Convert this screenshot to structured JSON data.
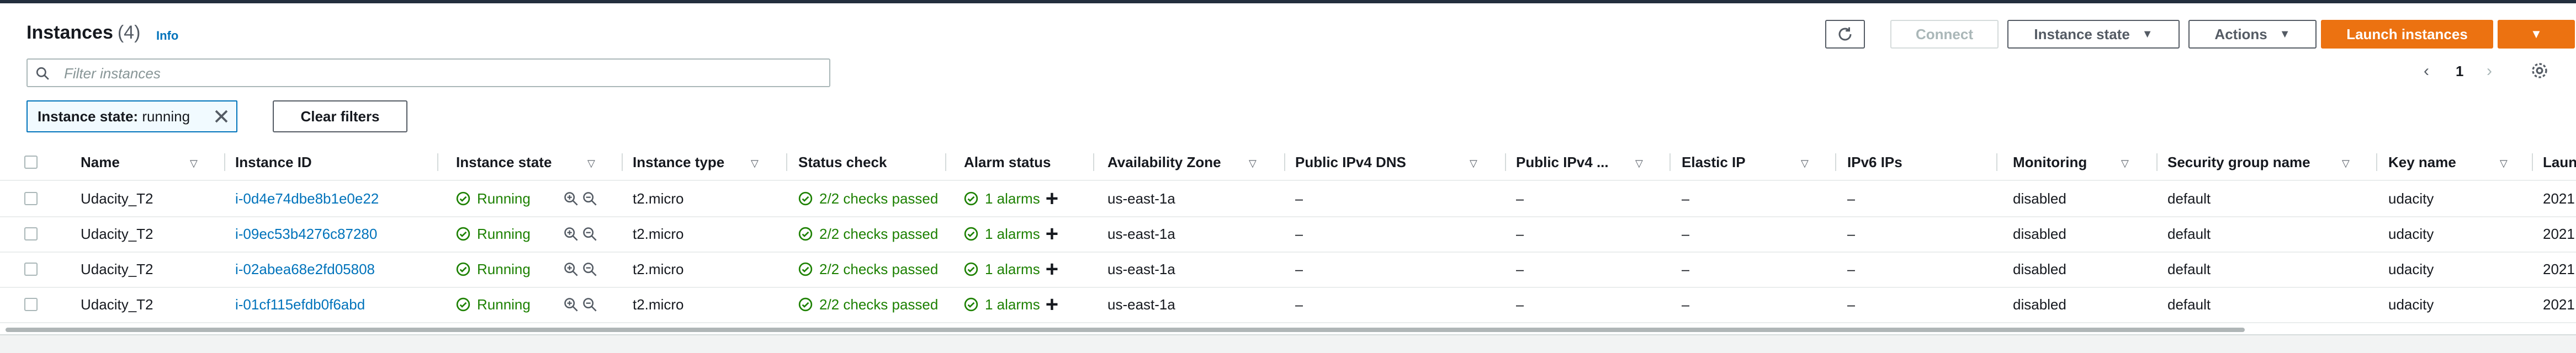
{
  "header": {
    "title": "Instances",
    "count": "(4)",
    "info": "Info"
  },
  "toolbar": {
    "connect": "Connect",
    "instance_state": "Instance state",
    "actions": "Actions",
    "launch": "Launch instances"
  },
  "search": {
    "placeholder": "Filter instances"
  },
  "filter_token": {
    "key": "Instance state:",
    "value": "running"
  },
  "clear_filters": "Clear filters",
  "pagination": {
    "page": "1"
  },
  "columns": {
    "name": "Name",
    "instance_id": "Instance ID",
    "instance_state": "Instance state",
    "instance_type": "Instance type",
    "status_check": "Status check",
    "alarm_status": "Alarm status",
    "az": "Availability Zone",
    "public_dns": "Public IPv4 DNS",
    "public_ip": "Public IPv4 ...",
    "elastic_ip": "Elastic IP",
    "ipv6": "IPv6 IPs",
    "monitoring": "Monitoring",
    "sg": "Security group name",
    "key": "Key name",
    "launch": "Laun"
  },
  "rows": [
    {
      "name": "Udacity_T2",
      "id": "i-0d4e74dbe8b1e0e22",
      "state": "Running",
      "type": "t2.micro",
      "status": "2/2 checks passed",
      "alarm": "1 alarms",
      "az": "us-east-1a",
      "dns": "–",
      "ip": "–",
      "eip": "–",
      "ipv6": "–",
      "monitoring": "disabled",
      "sg": "default",
      "key": "udacity",
      "launch": "2021"
    },
    {
      "name": "Udacity_T2",
      "id": "i-09ec53b4276c87280",
      "state": "Running",
      "type": "t2.micro",
      "status": "2/2 checks passed",
      "alarm": "1 alarms",
      "az": "us-east-1a",
      "dns": "–",
      "ip": "–",
      "eip": "–",
      "ipv6": "–",
      "monitoring": "disabled",
      "sg": "default",
      "key": "udacity",
      "launch": "2021"
    },
    {
      "name": "Udacity_T2",
      "id": "i-02abea68e2fd05808",
      "state": "Running",
      "type": "t2.micro",
      "status": "2/2 checks passed",
      "alarm": "1 alarms",
      "az": "us-east-1a",
      "dns": "–",
      "ip": "–",
      "eip": "–",
      "ipv6": "–",
      "monitoring": "disabled",
      "sg": "default",
      "key": "udacity",
      "launch": "2021"
    },
    {
      "name": "Udacity_T2",
      "id": "i-01cf115efdb0f6abd",
      "state": "Running",
      "type": "t2.micro",
      "status": "2/2 checks passed",
      "alarm": "1 alarms",
      "az": "us-east-1a",
      "dns": "–",
      "ip": "–",
      "eip": "–",
      "ipv6": "–",
      "monitoring": "disabled",
      "sg": "default",
      "key": "udacity",
      "launch": "2021"
    }
  ],
  "icons": {
    "refresh": "refresh-icon",
    "search": "search-icon",
    "close": "close-icon",
    "settings": "gear-icon",
    "check": "check-circle-icon",
    "zoom": "zoom-icon"
  },
  "colors": {
    "accent": "#ec7211",
    "link": "#0073bb",
    "success": "#1d8102"
  }
}
